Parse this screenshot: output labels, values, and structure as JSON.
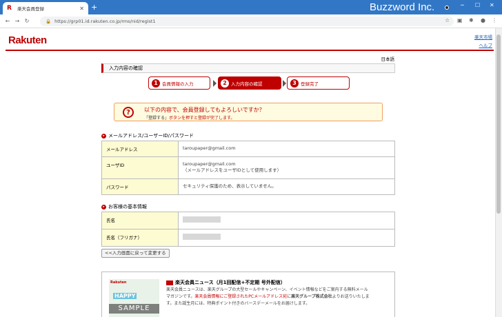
{
  "browser": {
    "tab_title": "楽天会員登録",
    "tab_icon_letter": "R",
    "url": "https://grp01.id.rakuten.co.jp/rms/nid/regist1",
    "overlay_brand": "Buzzword Inc."
  },
  "header": {
    "logo": "Rakuten",
    "link_market": "楽天市場",
    "link_help": "ヘルプ",
    "language": "日本語"
  },
  "section_title": "入力内容の確認",
  "steps": [
    {
      "num": "1",
      "label": "会員情報の入力"
    },
    {
      "num": "2",
      "label": "入力内容の確認"
    },
    {
      "num": "3",
      "label": "登録完了"
    }
  ],
  "confirm": {
    "message": "以下の内容で、会員登録してもよろしいですか？",
    "sub_prefix": "「登録する」",
    "sub_suffix": "ボタンを押すと登録が完了します。"
  },
  "account_block": {
    "title": "メールアドレス/ユーザーID/パスワード",
    "rows": [
      {
        "label": "メールアドレス",
        "value": "taroupaper@gmail.com",
        "note": ""
      },
      {
        "label": "ユーザID",
        "value": "taroupaper@gmail.com",
        "note": "（メールアドレスをユーザIDとして使用します）"
      },
      {
        "label": "パスワード",
        "value": "セキュリティ保護のため、表示していません。",
        "note": ""
      }
    ]
  },
  "basic_block": {
    "title": "お客様の基本情報",
    "rows": [
      {
        "label": "氏名"
      },
      {
        "label": "氏名（フリガナ）"
      }
    ]
  },
  "back_button": "<<入力画面に戻って変更する",
  "newsletter": {
    "title": "楽天会員ニュース（月1回配信+不定期 号外配信）",
    "thumb_logo": "Rakuten",
    "thumb_happy": "HAPPY",
    "thumb_sample": "SAMPLE",
    "text1": "楽天会員ニュースは、楽天グループの大型セールやキャンペーン、イベント情報などをご案内する無料メール",
    "text2": "マガジンです。",
    "text2_red": "楽天会員情報にご登録されたPCメールアドレス宛",
    "text2_mid": "に",
    "text2_bold": "楽天グループ株式会社",
    "text2_end": "よりお送りいたしま",
    "text3": "す。また誕生月には、特典ポイント付きのバースデーメールをお届けします。"
  }
}
